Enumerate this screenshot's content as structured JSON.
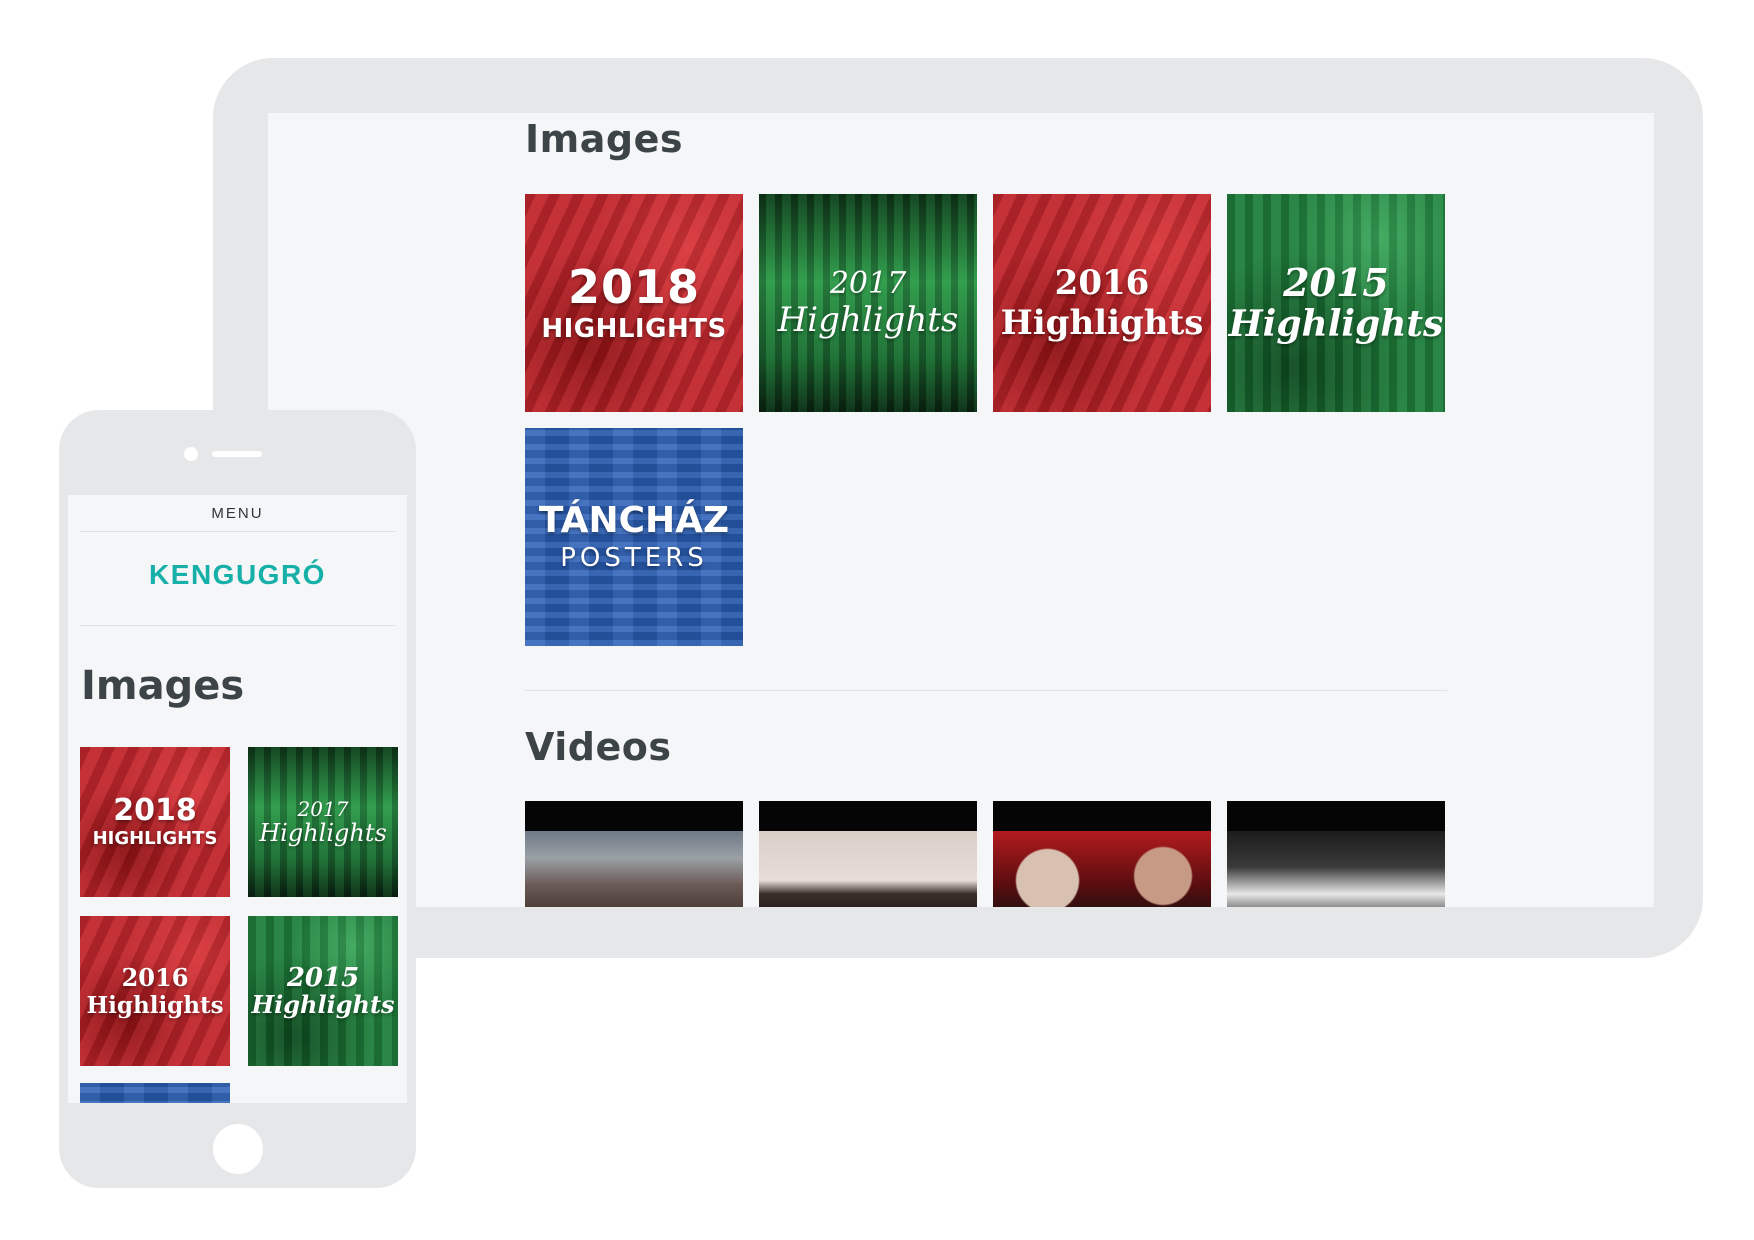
{
  "tablet": {
    "images_heading": "Images",
    "videos_heading": "Videos",
    "image_tiles": [
      {
        "line1": "2018",
        "line2": "HIGHLIGHTS",
        "theme": "red"
      },
      {
        "line1": "2017",
        "line2": "Highlights",
        "theme": "green-dark"
      },
      {
        "line1": "2016",
        "line2": "Highlights",
        "theme": "red"
      },
      {
        "line1": "2015",
        "line2": "Highlights",
        "theme": "green"
      },
      {
        "line1": "TÁNCHÁZ",
        "line2": "POSTERS",
        "theme": "blue"
      }
    ]
  },
  "phone": {
    "menu_label": "MENU",
    "brand": "KENGUGRÓ",
    "images_heading": "Images",
    "image_tiles": [
      {
        "line1": "2018",
        "line2": "HIGHLIGHTS"
      },
      {
        "line1": "2017",
        "line2": "Highlights"
      },
      {
        "line1": "2016",
        "line2": "Highlights"
      },
      {
        "line1": "2015",
        "line2": "Highlights"
      }
    ]
  },
  "colors": {
    "brand_teal": "#16b0a8",
    "heading": "#3d4447",
    "red": "#c1272d",
    "green": "#1f7f3c",
    "blue": "#2a5fb8",
    "device_frame": "#e6e7e9"
  }
}
